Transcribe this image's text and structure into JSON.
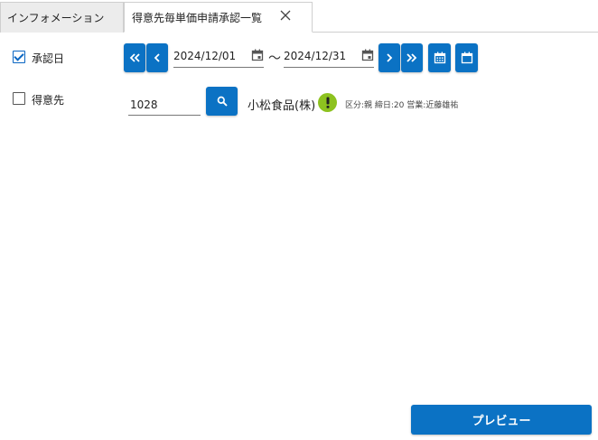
{
  "tabs": [
    {
      "label": "インフォメーション",
      "active": false
    },
    {
      "label": "得意先毎単価申請承認一覧",
      "active": true
    }
  ],
  "tab_close_icon": "close-icon",
  "approval_date": {
    "label": "承認日",
    "checked": true,
    "from": "2024/12/01",
    "separator": "～",
    "to": "2024/12/31"
  },
  "customer": {
    "label": "得意先",
    "checked": false,
    "code": "1028",
    "name": "小松食品(株)",
    "info": "区分:親 締日:20 営業:近藤雄祐"
  },
  "preview_label": "プレビュー",
  "colors": {
    "accent": "#0b72c4",
    "warn": "#8dc21f"
  }
}
